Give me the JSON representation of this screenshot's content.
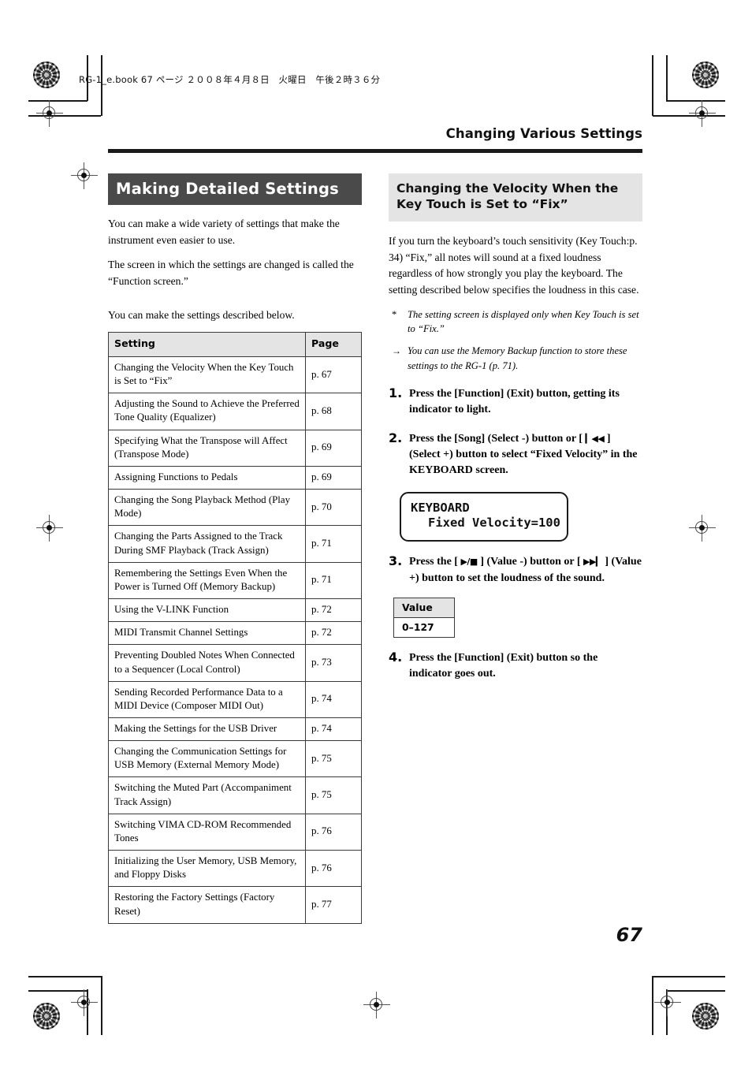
{
  "file_header": "RG-1_e.book  67 ページ  ２００８年４月８日　火曜日　午後２時３６分",
  "running_head": "Changing Various Settings",
  "folio": "67",
  "left_column": {
    "banner": "Making Detailed Settings",
    "intro_1": "You can make a wide variety of settings that make the instrument even easier to use.",
    "intro_2": "The screen in which the settings are changed is called the “Function screen.”",
    "intro_3": "You can make the settings described below.",
    "table": {
      "headers": [
        "Setting",
        "Page"
      ],
      "rows": [
        {
          "setting": "Changing the Velocity When the Key Touch is Set to “Fix”",
          "page": "p. 67"
        },
        {
          "setting": "Adjusting the Sound to Achieve the Preferred Tone Quality (Equalizer)",
          "page": "p. 68"
        },
        {
          "setting": "Specifying What the Transpose will Affect (Transpose Mode)",
          "page": "p. 69"
        },
        {
          "setting": "Assigning Functions to Pedals",
          "page": "p. 69"
        },
        {
          "setting": "Changing the Song Playback Method (Play Mode)",
          "page": "p. 70"
        },
        {
          "setting": "Changing the Parts Assigned to the Track During SMF Playback (Track Assign)",
          "page": "p. 71"
        },
        {
          "setting": "Remembering the Settings Even When the Power is Turned Off (Memory Backup)",
          "page": "p. 71"
        },
        {
          "setting": "Using the V-LINK Function",
          "page": "p. 72"
        },
        {
          "setting": "MIDI Transmit Channel Settings",
          "page": "p. 72"
        },
        {
          "setting": "Preventing Doubled Notes When Connected to a Sequencer (Local Control)",
          "page": "p. 73"
        },
        {
          "setting": "Sending Recorded Performance Data to a MIDI Device (Composer MIDI Out)",
          "page": "p. 74"
        },
        {
          "setting": "Making the Settings for the USB Driver",
          "page": "p. 74"
        },
        {
          "setting": "Changing the Communication Settings for USB Memory (External Memory Mode)",
          "page": "p. 75"
        },
        {
          "setting": "Switching the Muted Part (Accompaniment Track Assign)",
          "page": "p. 75"
        },
        {
          "setting": "Switching VIMA CD-ROM Recommended Tones",
          "page": "p. 76"
        },
        {
          "setting": "Initializing the User Memory, USB Memory, and Floppy Disks",
          "page": "p. 76"
        },
        {
          "setting": "Restoring the Factory Settings (Factory Reset)",
          "page": "p. 77"
        }
      ]
    }
  },
  "right_column": {
    "banner": "Changing the Velocity When the Key Touch is Set to “Fix”",
    "intro": "If you turn the keyboard’s touch sensitivity (Key Touch:p. 34) “Fix,” all notes will sound at a fixed loudness regardless of how strongly you play the keyboard. The setting described below specifies the loudness in this case.",
    "note_asterisk_mark": "*",
    "note_asterisk": "The setting screen is displayed only when Key Touch is set to “Fix.”",
    "note_arrow_mark": "→",
    "note_arrow": "You can use the Memory Backup function to store these settings to the RG-1 (p. 71).",
    "steps": [
      {
        "num": "1.",
        "text_before": "Press the [Function] (Exit) button, getting its indicator to light.",
        "glyph": "",
        "text_after": ""
      },
      {
        "num": "2.",
        "text_before": "Press the [Song] (Select -) button or [ ",
        "glyph": "▎◀◀",
        "text_after": " ] (Select +) button to select “Fixed Velocity” in the KEYBOARD screen."
      },
      {
        "num": "3.",
        "text_before": "Press the [ ",
        "glyph": "▶/■",
        "text_after": " ] (Value -) button or [ ",
        "glyph2": "▶▶▎",
        "text_after2": " ] (Value +) button to set the loudness of the sound."
      },
      {
        "num": "4.",
        "text_before": "Press the [Function] (Exit) button so the indicator goes out.",
        "glyph": "",
        "text_after": ""
      }
    ],
    "lcd": {
      "line1": "KEYBOARD",
      "line2": "Fixed Velocity=100"
    },
    "value_table": {
      "header": "Value",
      "value": "0–127"
    }
  },
  "colors": {
    "banner_dark_bg": "#4a4a4a",
    "banner_gray_bg": "#e4e4e4",
    "rule": "#1a1a1a",
    "text": "#000000"
  }
}
